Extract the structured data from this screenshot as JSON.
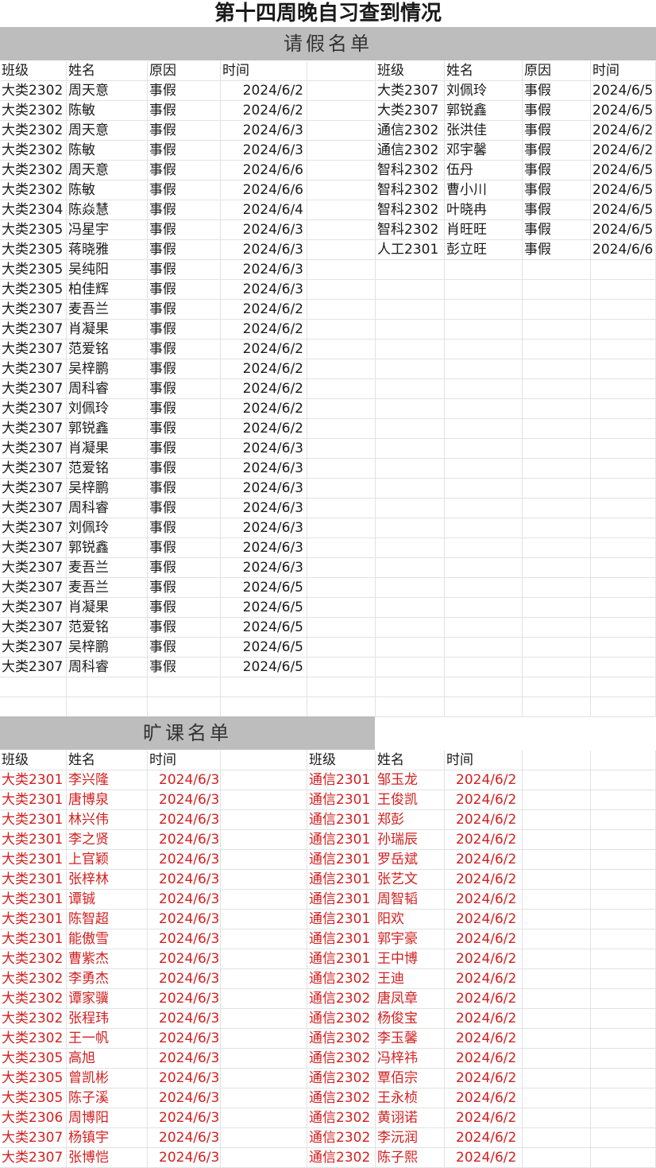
{
  "title": "第十四周晚自习查到情况",
  "leave": {
    "banner": "请假名单",
    "headers": [
      "班级",
      "姓名",
      "原因",
      "时间"
    ],
    "left_rows": [
      [
        "大类2302",
        "周天意",
        "事假",
        "2024/6/2"
      ],
      [
        "大类2302",
        "陈敏",
        "事假",
        "2024/6/2"
      ],
      [
        "大类2302",
        "周天意",
        "事假",
        "2024/6/3"
      ],
      [
        "大类2302",
        "陈敏",
        "事假",
        "2024/6/3"
      ],
      [
        "大类2302",
        "周天意",
        "事假",
        "2024/6/6"
      ],
      [
        "大类2302",
        "陈敏",
        "事假",
        "2024/6/6"
      ],
      [
        "大类2304",
        "陈焱慧",
        "事假",
        "2024/6/4"
      ],
      [
        "大类2305",
        "冯星宇",
        "事假",
        "2024/6/3"
      ],
      [
        "大类2305",
        "蒋晓雅",
        "事假",
        "2024/6/3"
      ],
      [
        "大类2305",
        "吴纯阳",
        "事假",
        "2024/6/3"
      ],
      [
        "大类2305",
        "柏佳辉",
        "事假",
        "2024/6/3"
      ],
      [
        "大类2307",
        "麦吾兰",
        "事假",
        "2024/6/2"
      ],
      [
        "大类2307",
        "肖凝果",
        "事假",
        "2024/6/2"
      ],
      [
        "大类2307",
        "范爱铭",
        "事假",
        "2024/6/2"
      ],
      [
        "大类2307",
        "吴梓鹏",
        "事假",
        "2024/6/2"
      ],
      [
        "大类2307",
        "周科睿",
        "事假",
        "2024/6/2"
      ],
      [
        "大类2307",
        "刘佩玲",
        "事假",
        "2024/6/2"
      ],
      [
        "大类2307",
        "郭锐鑫",
        "事假",
        "2024/6/2"
      ],
      [
        "大类2307",
        "肖凝果",
        "事假",
        "2024/6/3"
      ],
      [
        "大类2307",
        "范爱铭",
        "事假",
        "2024/6/3"
      ],
      [
        "大类2307",
        "吴梓鹏",
        "事假",
        "2024/6/3"
      ],
      [
        "大类2307",
        "周科睿",
        "事假",
        "2024/6/3"
      ],
      [
        "大类2307",
        "刘佩玲",
        "事假",
        "2024/6/3"
      ],
      [
        "大类2307",
        "郭锐鑫",
        "事假",
        "2024/6/3"
      ],
      [
        "大类2307",
        "麦吾兰",
        "事假",
        "2024/6/3"
      ],
      [
        "大类2307",
        "麦吾兰",
        "事假",
        "2024/6/5"
      ],
      [
        "大类2307",
        "肖凝果",
        "事假",
        "2024/6/5"
      ],
      [
        "大类2307",
        "范爱铭",
        "事假",
        "2024/6/5"
      ],
      [
        "大类2307",
        "吴梓鹏",
        "事假",
        "2024/6/5"
      ],
      [
        "大类2307",
        "周科睿",
        "事假",
        "2024/6/5"
      ]
    ],
    "right_rows": [
      [
        "大类2307",
        "刘佩玲",
        "事假",
        "2024/6/5"
      ],
      [
        "大类2307",
        "郭锐鑫",
        "事假",
        "2024/6/5"
      ],
      [
        "通信2302",
        "张洪佳",
        "事假",
        "2024/6/2"
      ],
      [
        "通信2302",
        "邓宇馨",
        "事假",
        "2024/6/2"
      ],
      [
        "智科2302",
        "伍丹",
        "事假",
        "2024/6/5"
      ],
      [
        "智科2302",
        "曹小川",
        "事假",
        "2024/6/5"
      ],
      [
        "智科2302",
        "叶晓冉",
        "事假",
        "2024/6/5"
      ],
      [
        "智科2302",
        "肖旺旺",
        "事假",
        "2024/6/5"
      ],
      [
        "人工2301",
        "彭立旺",
        "事假",
        "2024/6/6"
      ]
    ]
  },
  "absent": {
    "banner": "旷课名单",
    "headers": [
      "班级",
      "姓名",
      "时间"
    ],
    "left_rows": [
      [
        "大类2301",
        "李兴隆",
        "2024/6/3"
      ],
      [
        "大类2301",
        "唐博泉",
        "2024/6/3"
      ],
      [
        "大类2301",
        "林兴伟",
        "2024/6/3"
      ],
      [
        "大类2301",
        "李之贤",
        "2024/6/3"
      ],
      [
        "大类2301",
        "上官颖",
        "2024/6/3"
      ],
      [
        "大类2301",
        "张梓林",
        "2024/6/3"
      ],
      [
        "大类2301",
        "谭铖",
        "2024/6/3"
      ],
      [
        "大类2301",
        "陈智超",
        "2024/6/3"
      ],
      [
        "大类2301",
        "能傲雪",
        "2024/6/3"
      ],
      [
        "大类2302",
        "曹紫杰",
        "2024/6/3"
      ],
      [
        "大类2302",
        "李勇杰",
        "2024/6/3"
      ],
      [
        "大类2302",
        "谭家骥",
        "2024/6/3"
      ],
      [
        "大类2302",
        "张程玮",
        "2024/6/3"
      ],
      [
        "大类2302",
        "王一帆",
        "2024/6/3"
      ],
      [
        "大类2305",
        "高旭",
        "2024/6/3"
      ],
      [
        "大类2305",
        "曾凯彬",
        "2024/6/3"
      ],
      [
        "大类2305",
        "陈子溪",
        "2024/6/3"
      ],
      [
        "大类2306",
        "周博阳",
        "2024/6/3"
      ],
      [
        "大类2307",
        "杨镇宇",
        "2024/6/3"
      ],
      [
        "大类2307",
        "张博恺",
        "2024/6/3"
      ]
    ],
    "right_rows": [
      [
        "通信2301",
        "邹玉龙",
        "2024/6/2"
      ],
      [
        "通信2301",
        "王俊凯",
        "2024/6/2"
      ],
      [
        "通信2301",
        "郑彭",
        "2024/6/2"
      ],
      [
        "通信2301",
        "孙瑞辰",
        "2024/6/2"
      ],
      [
        "通信2301",
        "罗岳斌",
        "2024/6/2"
      ],
      [
        "通信2301",
        "张艺文",
        "2024/6/2"
      ],
      [
        "通信2301",
        "周智韬",
        "2024/6/2"
      ],
      [
        "通信2301",
        "阳欢",
        "2024/6/2"
      ],
      [
        "通信2301",
        "郭宇豪",
        "2024/6/2"
      ],
      [
        "通信2301",
        "王中博",
        "2024/6/2"
      ],
      [
        "通信2302",
        "王迪",
        "2024/6/2"
      ],
      [
        "通信2302",
        "唐凤章",
        "2024/6/2"
      ],
      [
        "通信2302",
        "杨俊宝",
        "2024/6/2"
      ],
      [
        "通信2302",
        "李玉馨",
        "2024/6/2"
      ],
      [
        "通信2302",
        "冯梓祎",
        "2024/6/2"
      ],
      [
        "通信2302",
        "覃佰宗",
        "2024/6/2"
      ],
      [
        "通信2302",
        "王永桢",
        "2024/6/2"
      ],
      [
        "通信2302",
        "黄诩诺",
        "2024/6/2"
      ],
      [
        "通信2302",
        "李沅润",
        "2024/6/2"
      ],
      [
        "通信2302",
        "陈子熙",
        "2024/6/2"
      ]
    ]
  }
}
